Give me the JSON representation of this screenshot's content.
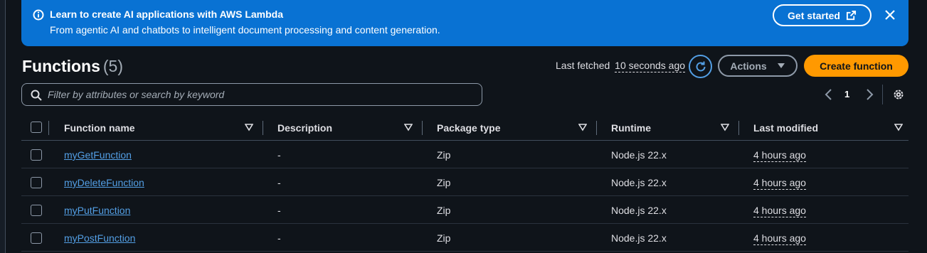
{
  "banner": {
    "title": "Learn to create AI applications with AWS Lambda",
    "description": "From agentic AI and chatbots to intelligent document processing and content generation.",
    "get_started_label": "Get started",
    "color": "#0972d3"
  },
  "header": {
    "title": "Functions",
    "count": "(5)",
    "last_fetched_label": "Last fetched",
    "last_fetched_value": "10 seconds ago",
    "actions_label": "Actions",
    "create_label": "Create function"
  },
  "filter": {
    "placeholder": "Filter by attributes or search by keyword"
  },
  "pagination": {
    "current_page": "1"
  },
  "table": {
    "columns": [
      "Function name",
      "Description",
      "Package type",
      "Runtime",
      "Last modified"
    ],
    "rows": [
      {
        "name": "myGetFunction",
        "description": "-",
        "package_type": "Zip",
        "runtime": "Node.js 22.x",
        "last_modified": "4 hours ago"
      },
      {
        "name": "myDeleteFunction",
        "description": "-",
        "package_type": "Zip",
        "runtime": "Node.js 22.x",
        "last_modified": "4 hours ago"
      },
      {
        "name": "myPutFunction",
        "description": "-",
        "package_type": "Zip",
        "runtime": "Node.js 22.x",
        "last_modified": "4 hours ago"
      },
      {
        "name": "myPostFunction",
        "description": "-",
        "package_type": "Zip",
        "runtime": "Node.js 22.x",
        "last_modified": "4 hours ago"
      }
    ]
  },
  "icons": {
    "banner_info": "info-icon",
    "banner_external": "external-link-icon",
    "banner_close": "close-icon",
    "refresh": "refresh-icon",
    "actions_caret": "caret-down-icon",
    "search": "search-icon",
    "prev": "chevron-left-icon",
    "next": "chevron-right-icon",
    "settings": "gear-icon",
    "sort": "sort-caret-icon"
  },
  "colors": {
    "background": "#0f141a",
    "primary_button": "#ff9900",
    "link": "#539fe5",
    "text": "#dedee3"
  }
}
